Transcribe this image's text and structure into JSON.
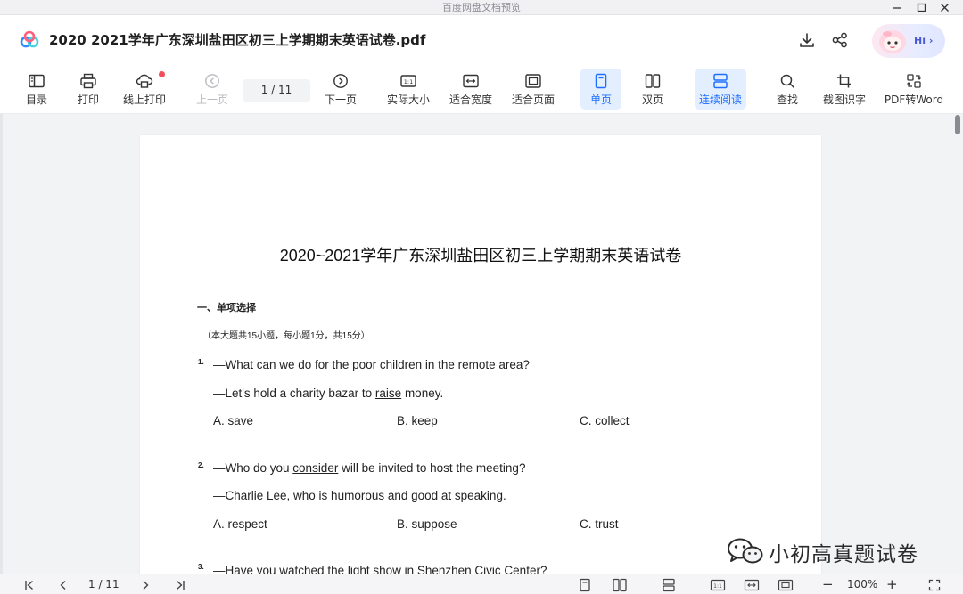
{
  "app": {
    "window_title": "百度网盘文档预览",
    "document_title": "2020  2021学年广东深圳盐田区初三上学期期末英语试卷.pdf",
    "hi_label": "Hi",
    "hi_arrow": "›"
  },
  "toolbar": {
    "catalog": "目录",
    "print": "打印",
    "online_print": "线上打印",
    "prev_page": "上一页",
    "page_indicator": "1  / 11",
    "next_page": "下一页",
    "actual_size": "实际大小",
    "fit_width": "适合宽度",
    "fit_page": "适合页面",
    "single_page": "单页",
    "double_page": "双页",
    "continuous": "连续阅读",
    "find": "查找",
    "screenshot_ocr": "截图识字",
    "pdf_to_word": "PDF转Word"
  },
  "document": {
    "title": "2020~2021学年广东深圳盐田区初三上学期期末英语试卷",
    "section": "一、单项选择",
    "note": "（本大题共15小题，每小题1分，共15分）",
    "questions": [
      {
        "num": "1.",
        "line1": "—What can we do for the poor children in the remote area?",
        "line2_pre": "—Let's hold a charity bazar to ",
        "line2_u": "raise",
        "line2_post": " money.",
        "options": [
          "A. save",
          "B. keep",
          "C. collect"
        ]
      },
      {
        "num": "2.",
        "line1_pre": "—Who do you ",
        "line1_u": "consider",
        "line1_post": " will be invited to host the meeting?",
        "line2": "—Charlie Lee, who is humorous and good at speaking.",
        "options": [
          "A. respect",
          "B. suppose",
          "C. trust"
        ]
      },
      {
        "num": "3.",
        "line1": "—Have you watched the light show in Shenzhen Civic Center?"
      }
    ]
  },
  "watermark": "小初高真题试卷",
  "bottombar": {
    "page_indicator": "1  / 11",
    "zoom": "100%",
    "zoom_minus": "−",
    "zoom_plus": "+"
  },
  "colors": {
    "accent": "#1e6fff",
    "active_bg": "#e3eeff",
    "viewer_bg": "#f2f3f5",
    "red_dot": "#f24e5b"
  },
  "icons": [
    "baidu-netdisk-logo-icon",
    "download-icon",
    "share-icon",
    "assistant-avatar-icon"
  ]
}
